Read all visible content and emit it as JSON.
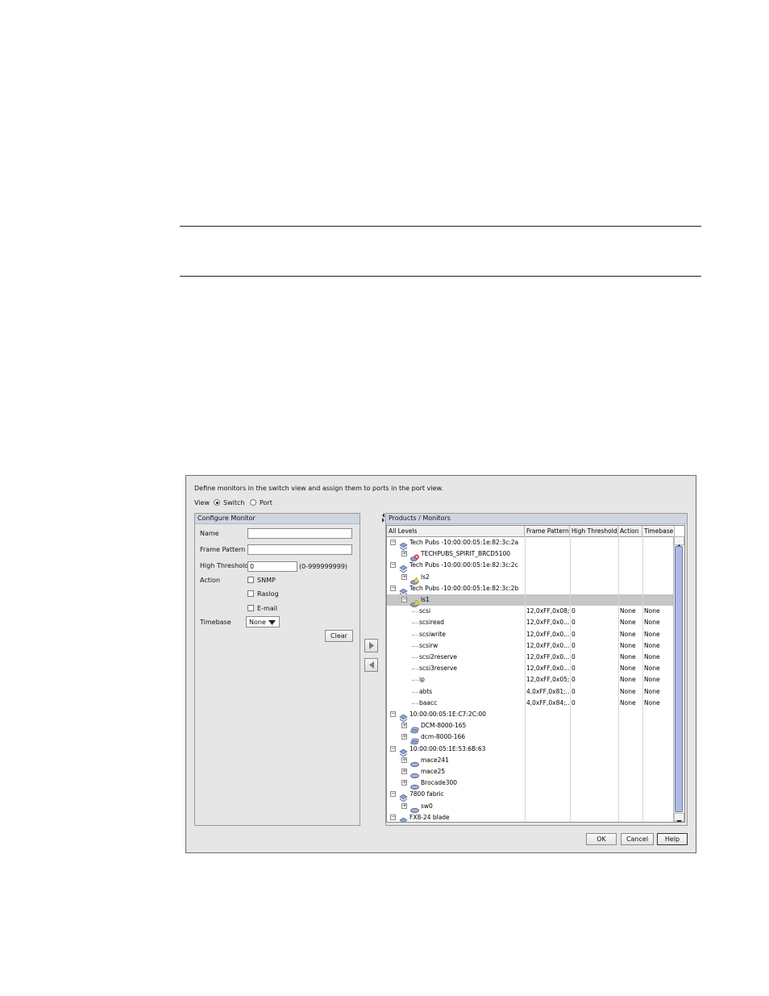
{
  "dialog": {
    "description": "Define monitors in the switch view and assign them to ports in the port view.",
    "view": {
      "label": "View",
      "options": [
        "Switch",
        "Port"
      ],
      "selected": "Switch"
    },
    "configure_monitor": {
      "title": "Configure Monitor",
      "name_label": "Name",
      "name_value": "",
      "frame_pattern_label": "Frame Pattern",
      "frame_pattern_value": "",
      "high_threshold_label": "High Threshold",
      "high_threshold_value": "0",
      "high_threshold_range": "(0-999999999)",
      "action_label": "Action",
      "actions": [
        {
          "label": "SNMP",
          "checked": false
        },
        {
          "label": "Raslog",
          "checked": false
        },
        {
          "label": "E-mail",
          "checked": false
        }
      ],
      "timebase_label": "Timebase",
      "timebase_value": "None",
      "clear_label": "Clear"
    },
    "products": {
      "title": "Products / Monitors",
      "columns": [
        "All Levels",
        "Frame Pattern",
        "High Threshold",
        "Action",
        "Timebase"
      ],
      "rows": [
        {
          "level": 0,
          "expander": "minus",
          "icon": "fabric-icon",
          "name": "Tech Pubs -10:00:00:05:1e:82:3c:2a",
          "fp": "",
          "ht": "",
          "action": "",
          "tb": ""
        },
        {
          "level": 1,
          "expander": "plus",
          "icon": "switch-error-icon",
          "name": "TECHPUBS_SPIRIT_BRCD5100",
          "fp": "",
          "ht": "",
          "action": "",
          "tb": ""
        },
        {
          "level": 0,
          "expander": "minus",
          "icon": "fabric-icon",
          "name": "Tech Pubs -10:00:00:05:1e:82:3c:2c",
          "fp": "",
          "ht": "",
          "action": "",
          "tb": ""
        },
        {
          "level": 1,
          "expander": "plus",
          "icon": "switch-warning-icon",
          "name": "ls2",
          "fp": "",
          "ht": "",
          "action": "",
          "tb": ""
        },
        {
          "level": 0,
          "expander": "minus",
          "icon": "fabric-icon",
          "name": "Tech Pubs -10:00:00:05:1e:82:3c:2b",
          "fp": "",
          "ht": "",
          "action": "",
          "tb": ""
        },
        {
          "level": 1,
          "expander": "minus",
          "icon": "switch-warning-icon",
          "name": "ls1",
          "fp": "",
          "ht": "",
          "action": "",
          "tb": "",
          "selected": true
        },
        {
          "level": 2,
          "expander": "",
          "icon": "",
          "name": "scsi",
          "fp": "12,0xFF,0x08;",
          "ht": "0",
          "action": "None",
          "tb": "None"
        },
        {
          "level": 2,
          "expander": "",
          "icon": "",
          "name": "scsiread",
          "fp": "12,0xFF,0x0...",
          "ht": "0",
          "action": "None",
          "tb": "None"
        },
        {
          "level": 2,
          "expander": "",
          "icon": "",
          "name": "scsiwrite",
          "fp": "12,0xFF,0x0...",
          "ht": "0",
          "action": "None",
          "tb": "None"
        },
        {
          "level": 2,
          "expander": "",
          "icon": "",
          "name": "scsirw",
          "fp": "12,0xFF,0x0...",
          "ht": "0",
          "action": "None",
          "tb": "None"
        },
        {
          "level": 2,
          "expander": "",
          "icon": "",
          "name": "scsi2reserve",
          "fp": "12,0xFF,0x0...",
          "ht": "0",
          "action": "None",
          "tb": "None"
        },
        {
          "level": 2,
          "expander": "",
          "icon": "",
          "name": "scsi3reserve",
          "fp": "12,0xFF,0x0...",
          "ht": "0",
          "action": "None",
          "tb": "None"
        },
        {
          "level": 2,
          "expander": "",
          "icon": "",
          "name": "ip",
          "fp": "12,0xFF,0x05;",
          "ht": "0",
          "action": "None",
          "tb": "None"
        },
        {
          "level": 2,
          "expander": "",
          "icon": "",
          "name": "abts",
          "fp": "4,0xFF,0x81;...",
          "ht": "0",
          "action": "None",
          "tb": "None"
        },
        {
          "level": 2,
          "expander": "",
          "icon": "",
          "name": "baacc",
          "fp": "4,0xFF,0x84;...",
          "ht": "0",
          "action": "None",
          "tb": "None"
        },
        {
          "level": 0,
          "expander": "minus",
          "icon": "fabric-icon",
          "name": "10:00:00:05:1E:C7:2C:00",
          "fp": "",
          "ht": "",
          "action": "",
          "tb": ""
        },
        {
          "level": 1,
          "expander": "plus",
          "icon": "switch-group-icon",
          "name": "DCM-8000-165",
          "fp": "",
          "ht": "",
          "action": "",
          "tb": ""
        },
        {
          "level": 1,
          "expander": "plus",
          "icon": "switch-group-icon",
          "name": "dcm-8000-166",
          "fp": "",
          "ht": "",
          "action": "",
          "tb": ""
        },
        {
          "level": 0,
          "expander": "minus",
          "icon": "fabric-icon",
          "name": "10:00:00:05:1E:53:6B:63",
          "fp": "",
          "ht": "",
          "action": "",
          "tb": ""
        },
        {
          "level": 1,
          "expander": "plus",
          "icon": "switch-icon",
          "name": "mace241",
          "fp": "",
          "ht": "",
          "action": "",
          "tb": ""
        },
        {
          "level": 1,
          "expander": "plus",
          "icon": "switch-icon",
          "name": "mace25",
          "fp": "",
          "ht": "",
          "action": "",
          "tb": ""
        },
        {
          "level": 1,
          "expander": "plus",
          "icon": "switch-icon",
          "name": "Brocade300",
          "fp": "",
          "ht": "",
          "action": "",
          "tb": ""
        },
        {
          "level": 0,
          "expander": "minus",
          "icon": "fabric-icon",
          "name": "7800 fabric",
          "fp": "",
          "ht": "",
          "action": "",
          "tb": ""
        },
        {
          "level": 1,
          "expander": "plus",
          "icon": "switch-icon",
          "name": "sw0",
          "fp": "",
          "ht": "",
          "action": "",
          "tb": ""
        },
        {
          "level": 0,
          "expander": "minus",
          "icon": "fabric-icon",
          "name": "FX8-24 blade",
          "fp": "",
          "ht": "",
          "action": "",
          "tb": ""
        }
      ]
    },
    "buttons": {
      "ok": "OK",
      "cancel": "Cancel",
      "help": "Help"
    }
  }
}
